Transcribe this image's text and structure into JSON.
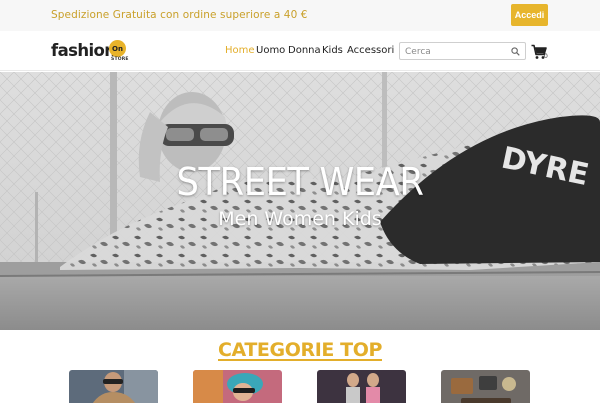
{
  "topbar": {
    "promo_text": "Spedizione Gratuita con ordine superiore a 40 €",
    "login_label": "Accedi"
  },
  "header": {
    "logo": {
      "text": "fashion",
      "badge": "On",
      "subtext": "STORE"
    },
    "nav": [
      {
        "label": "Home",
        "active": true
      },
      {
        "label": "Uomo",
        "active": false
      },
      {
        "label": "Donna",
        "active": false
      },
      {
        "label": "Kids",
        "active": false
      },
      {
        "label": "Accessori",
        "active": false
      }
    ],
    "search": {
      "placeholder": "Cerca",
      "value": ""
    },
    "cart": {
      "count": "0"
    }
  },
  "hero": {
    "title": "STREET WEAR",
    "subtitle": "Men Women Kids"
  },
  "categories": {
    "title": "CATEGORIE TOP",
    "items": [
      {
        "icon": "category-photo-men"
      },
      {
        "icon": "category-photo-women"
      },
      {
        "icon": "category-photo-kids"
      },
      {
        "icon": "category-photo-accessories"
      }
    ]
  },
  "colors": {
    "accent": "#e3ae2b",
    "button": "#e7b52c",
    "topbar_bg": "#f7f7f7"
  }
}
